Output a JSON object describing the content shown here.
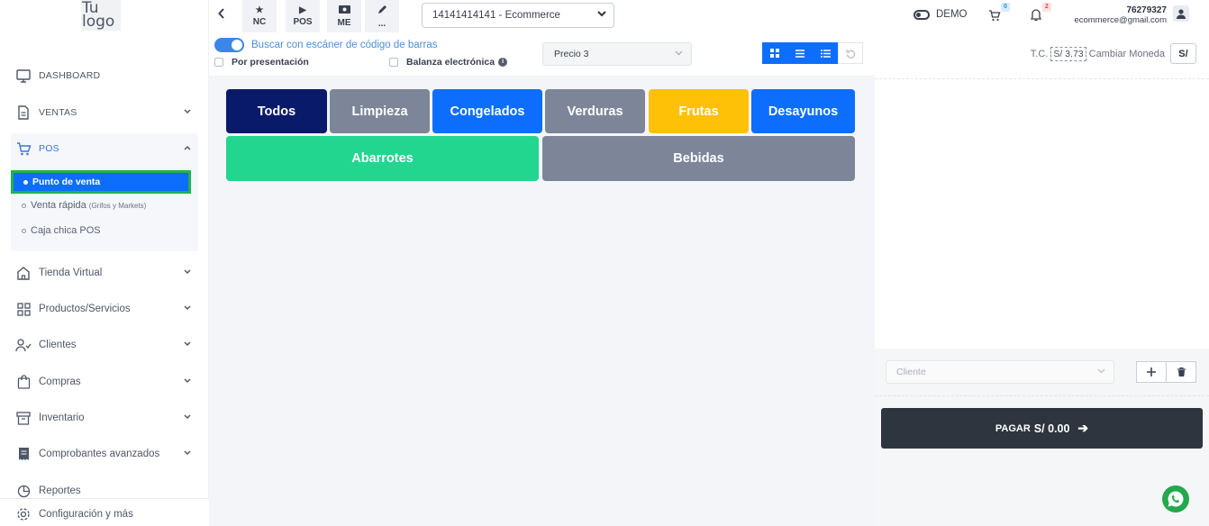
{
  "logo": {
    "line1": "Tu",
    "line2": "logo"
  },
  "sidebar": {
    "items": [
      {
        "label": "DASHBOARD"
      },
      {
        "label": "VENTAS"
      },
      {
        "label": "POS"
      },
      {
        "label": "Tienda Virtual"
      },
      {
        "label": "Productos/Servicios"
      },
      {
        "label": "Clientes"
      },
      {
        "label": "Compras"
      },
      {
        "label": "Inventario"
      },
      {
        "label": "Comprobantes avanzados"
      },
      {
        "label": "Reportes"
      },
      {
        "label": "Configuración y más"
      }
    ],
    "pos_sub": [
      {
        "label": "Punto de venta"
      },
      {
        "label": "Venta rápida",
        "note": "(Grifos y Markets)"
      },
      {
        "label": "Caja chica POS"
      }
    ]
  },
  "toolbar": {
    "buttons": [
      {
        "label": "NC",
        "icon": "star-icon"
      },
      {
        "label": "POS",
        "icon": "play-icon"
      },
      {
        "label": "ME",
        "icon": "cash-icon"
      },
      {
        "label": "...",
        "icon": "pencil-icon"
      }
    ],
    "company": "14141414141 - Ecommerce",
    "demo_label": "DEMO",
    "cart_count": "0",
    "notif_count": "2",
    "user_id": "76279327",
    "user_email": "ecommerce@gmail.com"
  },
  "options": {
    "scanner_label": "Buscar con escáner de código de barras",
    "presentation_label": "Por presentación",
    "scale_label": "Balanza electrónica",
    "price_select": "Precio 3"
  },
  "categories": [
    {
      "label": "Todos",
      "color": "#0a1a6b"
    },
    {
      "label": "Limpieza",
      "color": "#7d8699"
    },
    {
      "label": "Congelados",
      "color": "#0d6efd"
    },
    {
      "label": "Verduras",
      "color": "#7d8699"
    },
    {
      "label": "Frutas",
      "color": "#ffc107"
    },
    {
      "label": "Desayunos",
      "color": "#0d6efd"
    },
    {
      "label": "Abarrotes",
      "color": "#22d68f"
    },
    {
      "label": "Bebidas",
      "color": "#7d8699"
    }
  ],
  "exchange": {
    "tc_label": "T.C.",
    "rate": "S/ 3.73",
    "change_label": "Cambiar Moneda",
    "currency_button": "S/"
  },
  "checkout": {
    "client_placeholder": "Cliente",
    "pay_label": "PAGAR",
    "pay_amount": "S/ 0.00"
  }
}
